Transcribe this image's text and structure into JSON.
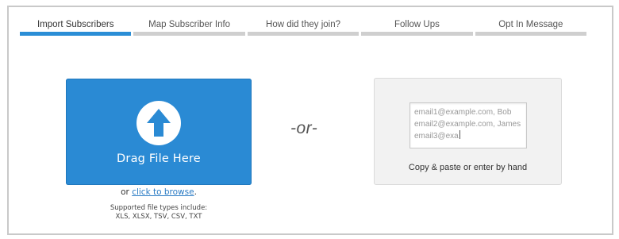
{
  "steps": [
    {
      "label": "Import Subscribers",
      "active": true
    },
    {
      "label": "Map Subscriber Info",
      "active": false
    },
    {
      "label": "How did they join?",
      "active": false
    },
    {
      "label": "Follow Ups",
      "active": false
    },
    {
      "label": "Opt In Message",
      "active": false
    }
  ],
  "upload": {
    "drop_label": "Drag File Here",
    "browse_prefix": "or",
    "browse_link": "click to browse",
    "browse_suffix": ".",
    "supported_line1": "Supported file types include:",
    "supported_line2": "XLS, XLSX, TSV, CSV, TXT",
    "icon": "upload-arrow-icon"
  },
  "separator": "-or-",
  "paste": {
    "lines": [
      "email1@example.com, Bob",
      "email2@example.com, James",
      "email3@exa"
    ],
    "caption": "Copy & paste or enter by hand"
  },
  "colors": {
    "accent": "#2a8ad4",
    "step_active": "#2b8ed6",
    "step_inactive": "#cfcfcf",
    "link": "#2a7bc4"
  }
}
